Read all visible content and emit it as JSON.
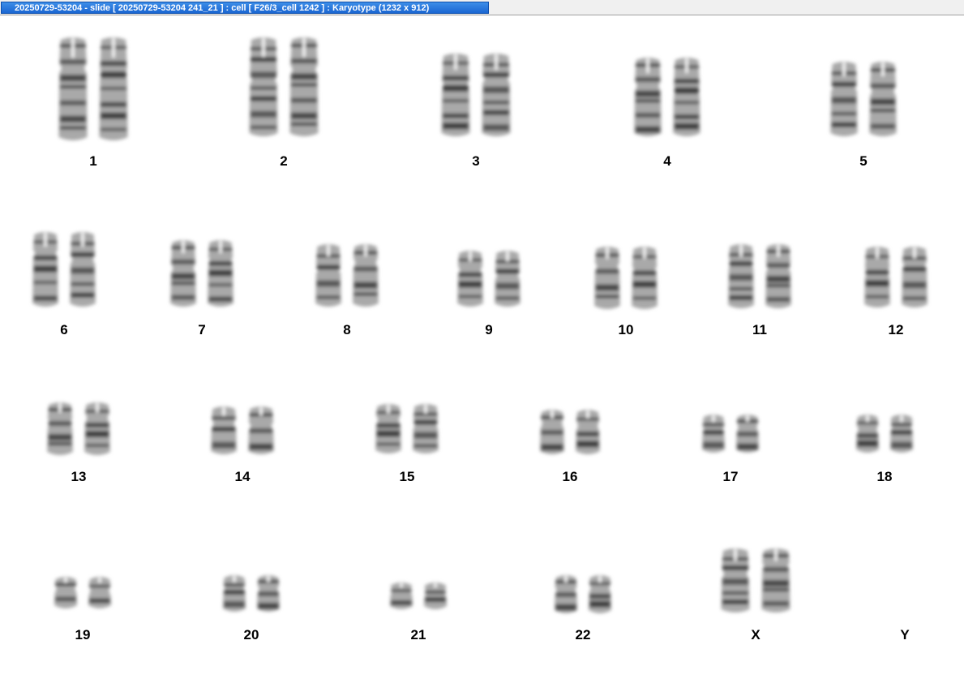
{
  "window": {
    "title": "20250729-53204 - slide [ 20250729-53204 241_21 ] : cell [ F26/3_cell 1242 ] : Karyotype  (1232 x 912)"
  },
  "karyotype": {
    "chromosomes": [
      {
        "label": "1",
        "copies": 2
      },
      {
        "label": "2",
        "copies": 2
      },
      {
        "label": "3",
        "copies": 2
      },
      {
        "label": "4",
        "copies": 2
      },
      {
        "label": "5",
        "copies": 2
      },
      {
        "label": "6",
        "copies": 2
      },
      {
        "label": "7",
        "copies": 2
      },
      {
        "label": "8",
        "copies": 2
      },
      {
        "label": "9",
        "copies": 2
      },
      {
        "label": "10",
        "copies": 2
      },
      {
        "label": "11",
        "copies": 2
      },
      {
        "label": "12",
        "copies": 2
      },
      {
        "label": "13",
        "copies": 2
      },
      {
        "label": "14",
        "copies": 2
      },
      {
        "label": "15",
        "copies": 2
      },
      {
        "label": "16",
        "copies": 2
      },
      {
        "label": "17",
        "copies": 2
      },
      {
        "label": "18",
        "copies": 2
      },
      {
        "label": "19",
        "copies": 2
      },
      {
        "label": "20",
        "copies": 2
      },
      {
        "label": "21",
        "copies": 2
      },
      {
        "label": "22",
        "copies": 2
      },
      {
        "label": "X",
        "copies": 2
      },
      {
        "label": "Y",
        "copies": 0
      }
    ]
  }
}
